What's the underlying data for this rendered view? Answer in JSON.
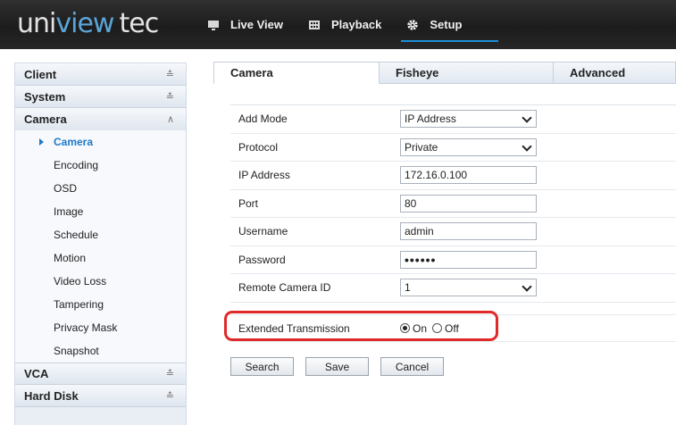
{
  "brand": {
    "logo_uni": "uni",
    "logo_view": "view",
    "logo_tec": "tec"
  },
  "topnav": [
    {
      "label": "Live View",
      "icon": "monitor-icon"
    },
    {
      "label": "Playback",
      "icon": "film-icon"
    },
    {
      "label": "Setup",
      "icon": "gear-icon",
      "active": true
    }
  ],
  "sidebar": {
    "client": "Client",
    "system": "System",
    "camera": "Camera",
    "camera_items": [
      "Camera",
      "Encoding",
      "OSD",
      "Image",
      "Schedule",
      "Motion",
      "Video Loss",
      "Tampering",
      "Privacy Mask",
      "Snapshot"
    ],
    "vca": "VCA",
    "hard_disk": "Hard Disk"
  },
  "tabs": [
    "Camera",
    "Fisheye",
    "Advanced"
  ],
  "form": {
    "add_mode": {
      "label": "Add Mode",
      "value": "IP Address"
    },
    "protocol": {
      "label": "Protocol",
      "value": "Private"
    },
    "ip_address": {
      "label": "IP Address",
      "value": "172.16.0.100"
    },
    "port": {
      "label": "Port",
      "value": "80"
    },
    "username": {
      "label": "Username",
      "value": "admin"
    },
    "password": {
      "label": "Password",
      "value": "••••••"
    },
    "remote_camera_id": {
      "label": "Remote Camera ID",
      "value": "1"
    }
  },
  "extended": {
    "label": "Extended Transmission",
    "on": "On",
    "off": "Off",
    "selected": "On"
  },
  "buttons": {
    "search": "Search",
    "save": "Save",
    "cancel": "Cancel"
  },
  "colors": {
    "accent": "#1e78c8",
    "highlight": "#e02a2a",
    "logo_blue": "#5aa6d8"
  }
}
